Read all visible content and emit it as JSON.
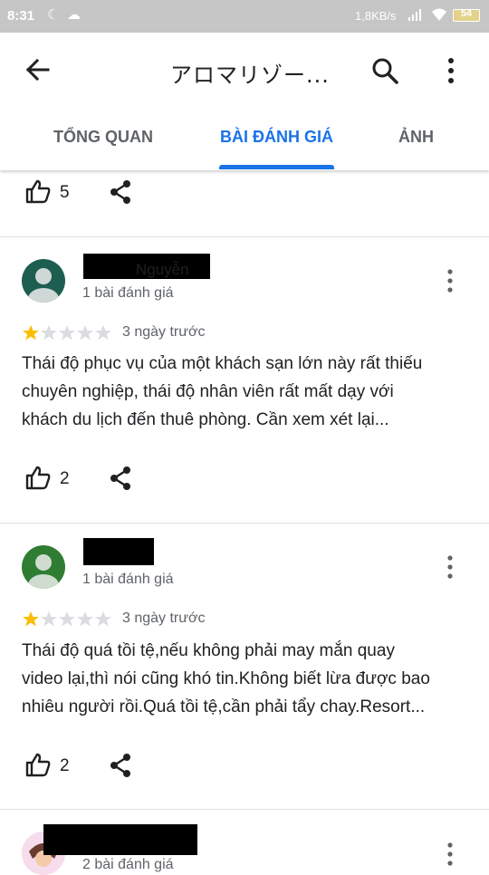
{
  "status_bar": {
    "time": "8:31",
    "net_speed": "1,8KB/s",
    "battery": "54"
  },
  "app_bar": {
    "title": "アロマリゾー..."
  },
  "tabs": [
    {
      "label": "TỔNG QUAN",
      "active": false
    },
    {
      "label": "BÀI ĐÁNH GIÁ",
      "active": true
    },
    {
      "label": "ẢNH",
      "active": false
    }
  ],
  "colors": {
    "accent": "#1a73e8",
    "star_filled": "#fbbc04",
    "star_empty": "#dadce0"
  },
  "top_partial": {
    "likes": "5"
  },
  "reviews": [
    {
      "name_partial": "Nguyễn",
      "review_count": "1 bài đánh giá",
      "rating": 1,
      "date": "3 ngày trước",
      "text_lines": [
        "Thái độ phục vụ của một khách sạn lớn này rất thiếu",
        "chuyên nghiệp, thái độ nhân viên rất mất dạy với",
        "khách du lịch đến thuê phòng. Cần xem xét lại..."
      ],
      "likes": "2"
    },
    {
      "review_count": "1 bài đánh giá",
      "rating": 1,
      "date": "3 ngày trước",
      "text_lines": [
        "Thái độ quá tồi tệ,nếu không phải may mắn quay",
        "video lại,thì nói cũng khó tin.Không biết lừa được bao",
        "nhiêu người rồi.Quá tồi tệ,cần phải tẩy chay.Resort..."
      ],
      "likes": "2"
    },
    {
      "review_count": "2 bài đánh giá"
    }
  ]
}
